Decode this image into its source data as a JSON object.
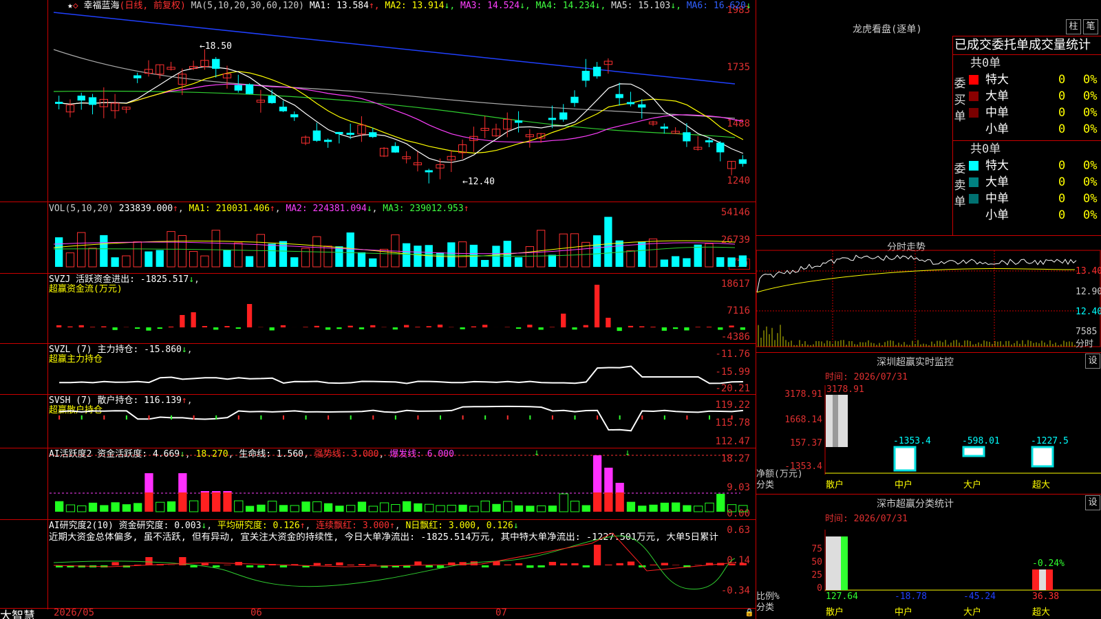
{
  "main": {
    "title": "幸福蓝海",
    "subtitle": "(日线, 前复权)",
    "ma_params": "MA(5,10,20,30,60,120)",
    "ma_values": [
      {
        "label": "MA1: 13.584",
        "arrow": "↑",
        "color": "#ffffff"
      },
      {
        "label": "MA2: 13.914",
        "arrow": "↓",
        "color": "#ffff00"
      },
      {
        "label": "MA3: 14.524",
        "arrow": "↓",
        "color": "#ff40ff"
      },
      {
        "label": "MA4: 14.234",
        "arrow": "↓",
        "color": "#40ff40"
      },
      {
        "label": "MA5: 15.103",
        "arrow": "↓",
        "color": "#dddddd"
      },
      {
        "label": "MA6: 16.620",
        "arrow": "↓",
        "color": "#3060ff"
      }
    ],
    "y_labels": [
      "1983",
      "1735",
      "1488",
      "1240"
    ],
    "high_mark": "18.50",
    "low_mark": "12.40"
  },
  "vol": {
    "params": "VOL(5,10,20)",
    "value": "233839.000",
    "ma1": "MA1: 210031.406",
    "ma2": "MA2: 224381.094",
    "ma3": "MA3: 239012.953",
    "y_labels": [
      "54146",
      "26739",
      "X10"
    ]
  },
  "svzj": {
    "label": "SVZJ  活跃资金进出: -1825.517",
    "subtitle": "超赢资金流(万元)",
    "y_labels": [
      "18617",
      "7116",
      "-4386"
    ]
  },
  "svzl": {
    "label": "SVZL (7) 主力持仓: -15.860",
    "subtitle": "超赢主力持仓",
    "y_labels": [
      "-11.76",
      "-15.99",
      "-20.21"
    ]
  },
  "svsh": {
    "label": "SVSH (7) 散户持仓: 116.139",
    "subtitle": "超赢散户持仓",
    "y_labels": [
      "119.22",
      "115.78",
      "112.47"
    ]
  },
  "ai_active": {
    "label": "AI活跃度2 资金活跃度: 4.669",
    "v2": "18.270",
    "v3": "生命线: 1.560",
    "v4": "强势线: 3.000",
    "v5": "爆发线: 6.000",
    "y_labels": [
      "18.27",
      "9.03",
      "0.00"
    ]
  },
  "ai_research": {
    "label": "AI研究度2(10) 资金研究度: 0.003",
    "v2": "平均研究度: 0.126",
    "v3": "连续飘红: 3.000",
    "v4": "N日飘红: 3.000, 0.126",
    "comment": "近期大资金总体偏多, 虽不活跃, 但有异动, 宜关注大资金的持续性, 今日大单净流出: -1825.514万元, 其中特大单净流出: -1227.501万元, 大单5日累计",
    "y_labels": [
      "0.63",
      "0.14",
      "-0.34"
    ]
  },
  "footer": {
    "brand": "大智慧",
    "dates": [
      "2026/05",
      "06",
      "07"
    ]
  },
  "right": {
    "dragon_title": "龙虎看盘(逐单)",
    "btn_col": "柱",
    "btn_bi": "笔",
    "stat_title": "已成交委托单成交量统计",
    "buy_total": "共0单",
    "sell_total": "共0单",
    "buy_side": "委买单",
    "sell_side": "委卖单",
    "rows": [
      {
        "label": "特大",
        "value": "0",
        "pct": "0%"
      },
      {
        "label": "大单",
        "value": "0",
        "pct": "0%"
      },
      {
        "label": "中单",
        "value": "0",
        "pct": "0%"
      },
      {
        "label": "小单",
        "value": "0",
        "pct": "0%"
      }
    ],
    "buy_colors": [
      "#ff0000",
      "#8b0000",
      "#7a0000",
      "#000000"
    ],
    "sell_colors": [
      "#00ffff",
      "#008080",
      "#007070",
      "#000000"
    ],
    "intraday_title": "分时走势",
    "intraday_labels": [
      "13.40",
      "12.90",
      "12.40",
      "7585",
      "分时"
    ],
    "monitor_title": "深圳超赢实时监控",
    "monitor_btn": "设",
    "monitor_time": "时间: 2026/07/31",
    "monitor_top": "3178.91",
    "monitor_y": [
      "3178.91",
      "1668.14",
      "157.37",
      "-1353.4"
    ],
    "monitor_values": [
      "-1353.4",
      "-598.01",
      "-1227.5"
    ],
    "monitor_ylabel": "净额(万元)",
    "monitor_cat": "分类",
    "cats": [
      "散户",
      "中户",
      "大户",
      "超大"
    ],
    "class_title": "深市超赢分类统计",
    "class_btn": "设",
    "class_time": "时间: 2026/07/31",
    "class_y": [
      "75",
      "50",
      "25",
      "0"
    ],
    "class_values": [
      "127.64",
      "-18.78",
      "-45.24",
      "36.38"
    ],
    "class_top": "-0.24%",
    "class_ylabel": "比例%",
    "class_cat": "分类"
  }
}
